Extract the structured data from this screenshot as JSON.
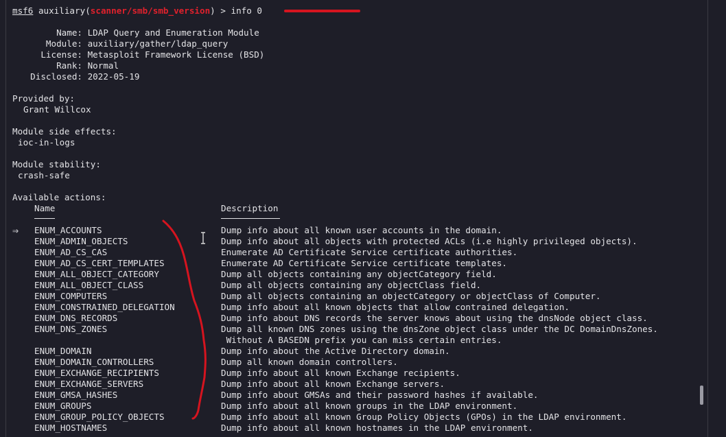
{
  "prompt": {
    "prefix": "msf6",
    "module_word": "auxiliary",
    "open_paren": "(",
    "module_path": "scanner/smb/smb_version",
    "close_paren": ")",
    "command": " > info 0"
  },
  "info": {
    "name_label": "Name:",
    "name_value": "LDAP Query and Enumeration Module",
    "module_label": "Module:",
    "module_value": "auxiliary/gather/ldap_query",
    "license_label": "License:",
    "license_value": "Metasploit Framework License (BSD)",
    "rank_label": "Rank:",
    "rank_value": "Normal",
    "disclosed_label": "Disclosed:",
    "disclosed_value": "2022-05-19"
  },
  "provided_by": {
    "header": "Provided by:",
    "author": "Grant Willcox"
  },
  "side_effects": {
    "header": "Module side effects:",
    "value": "ioc-in-logs"
  },
  "stability": {
    "header": "Module stability:",
    "value": "crash-safe"
  },
  "actions": {
    "header": "Available actions:",
    "col_name": "Name",
    "col_desc": "Description",
    "selected_marker": "⇒",
    "rows": [
      {
        "name": "ENUM_ACCOUNTS",
        "desc": "Dump info about all known user accounts in the domain."
      },
      {
        "name": "ENUM_ADMIN_OBJECTS",
        "desc": "Dump info about all objects with protected ACLs (i.e highly privileged objects)."
      },
      {
        "name": "ENUM_AD_CS_CAS",
        "desc": "Enumerate AD Certificate Service certificate authorities."
      },
      {
        "name": "ENUM_AD_CS_CERT_TEMPLATES",
        "desc": "Enumerate AD Certificate Service certificate templates."
      },
      {
        "name": "ENUM_ALL_OBJECT_CATEGORY",
        "desc": "Dump all objects containing any objectCategory field."
      },
      {
        "name": "ENUM_ALL_OBJECT_CLASS",
        "desc": "Dump all objects containing any objectClass field."
      },
      {
        "name": "ENUM_COMPUTERS",
        "desc": "Dump all objects containing an objectCategory or objectClass of Computer."
      },
      {
        "name": "ENUM_CONSTRAINED_DELEGATION",
        "desc": "Dump info about all known objects that allow contrained delegation."
      },
      {
        "name": "ENUM_DNS_RECORDS",
        "desc": "Dump info about DNS records the server knows about using the dnsNode object class."
      },
      {
        "name": "ENUM_DNS_ZONES",
        "desc": "Dump all known DNS zones using the dnsZone object class under the DC DomainDnsZones."
      },
      {
        "name": "",
        "desc": " Without A BASEDN prefix you can miss certain entries."
      },
      {
        "name": "ENUM_DOMAIN",
        "desc": "Dump info about the Active Directory domain."
      },
      {
        "name": "ENUM_DOMAIN_CONTROLLERS",
        "desc": "Dump all known domain controllers."
      },
      {
        "name": "ENUM_EXCHANGE_RECIPIENTS",
        "desc": "Dump info about all known Exchange recipients."
      },
      {
        "name": "ENUM_EXCHANGE_SERVERS",
        "desc": "Dump info about all known Exchange servers."
      },
      {
        "name": "ENUM_GMSA_HASHES",
        "desc": "Dump info about GMSAs and their password hashes if available."
      },
      {
        "name": "ENUM_GROUPS",
        "desc": "Dump info about all known groups in the LDAP environment."
      },
      {
        "name": "ENUM_GROUP_POLICY_OBJECTS",
        "desc": "Dump info about all known Group Policy Objects (GPOs) in the LDAP environment."
      },
      {
        "name": "ENUM_HOSTNAMES",
        "desc": "Dump info about all known hostnames in the LDAP environment."
      }
    ]
  },
  "colors": {
    "background": "#1e1e28",
    "text": "#e3e3e6",
    "accent_red": "#e0212c",
    "annotation_red": "#d5141f"
  },
  "icons": {
    "cursor": "text-cursor-icon",
    "selection": "double-arrow-icon"
  }
}
